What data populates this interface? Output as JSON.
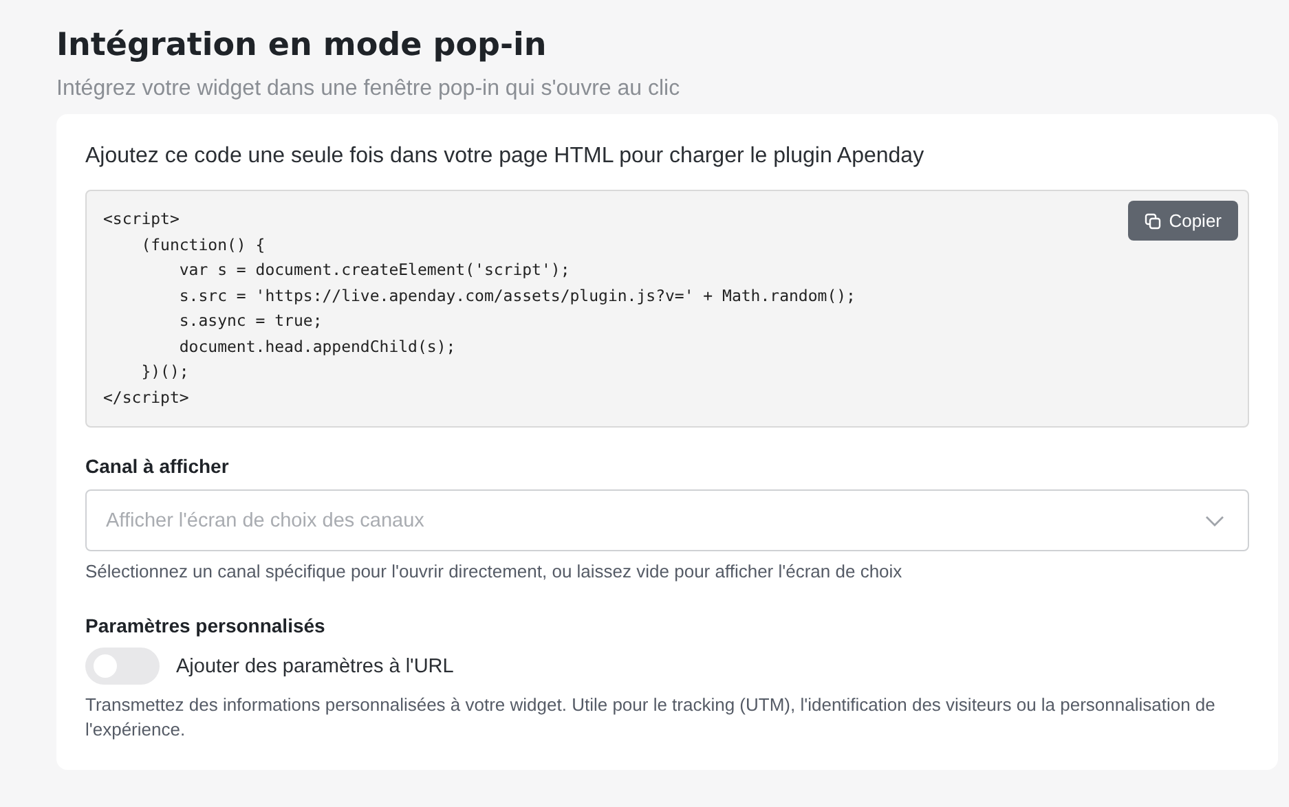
{
  "title": "Intégration en mode pop-in",
  "subtitle": "Intégrez votre widget dans une fenêtre pop-in qui s'ouvre au clic",
  "intro": "Ajoutez ce code une seule fois dans votre page HTML pour charger le plugin Apenday",
  "code": "<script>\n    (function() {\n        var s = document.createElement('script');\n        s.src = 'https://live.apenday.com/assets/plugin.js?v=' + Math.random();\n        s.async = true;\n        document.head.appendChild(s);\n    })();\n</script>",
  "copy_button": "Copier",
  "channel": {
    "label": "Canal à afficher",
    "placeholder": "Afficher l'écran de choix des canaux",
    "help": "Sélectionnez un canal spécifique pour l'ouvrir directement, ou laissez vide pour afficher l'écran de choix"
  },
  "params": {
    "label": "Paramètres personnalisés",
    "toggle_label": "Ajouter des paramètres à l'URL",
    "on": false,
    "help": "Transmettez des informations personnalisées à votre widget. Utile pour le tracking (UTM), l'identification des visiteurs ou la personnalisation de l'expérience."
  }
}
